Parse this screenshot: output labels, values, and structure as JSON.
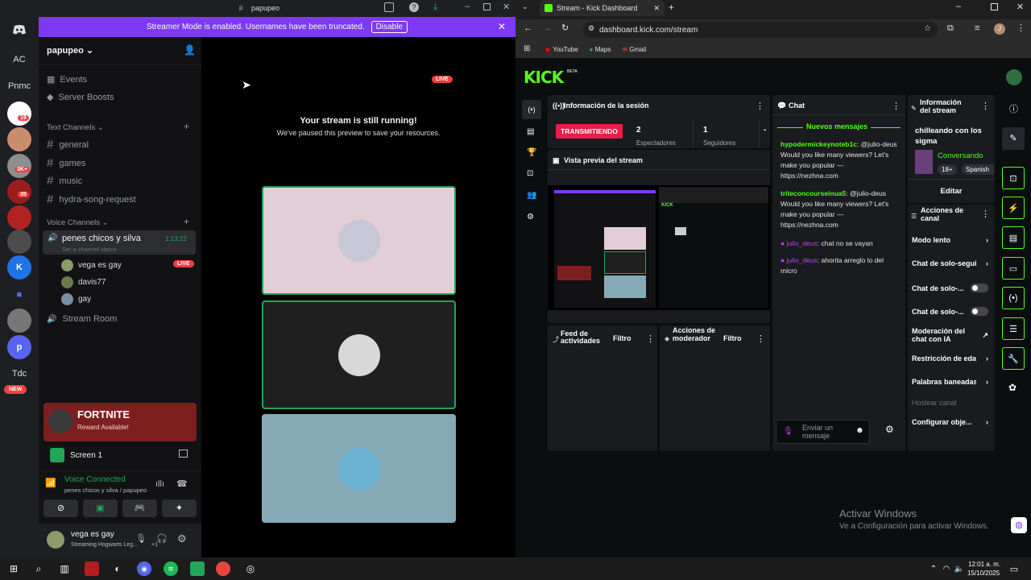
{
  "discord": {
    "window_title": "papupeo",
    "window_title_initial": "p",
    "banner": {
      "text": "Streamer Mode is enabled. Usernames have been truncated.",
      "button": "Disable"
    },
    "guilds": [
      {
        "label": "AC"
      },
      {
        "label": "Pnmc"
      },
      {
        "label": "Tdc"
      }
    ],
    "guild_badges": [
      "19",
      "3K+",
      "35"
    ],
    "new_badge": "NEW",
    "server_name": "papupeo",
    "menu": {
      "events": "Events",
      "boosts": "Server Boosts"
    },
    "text_channels_header": "Text Channels",
    "text_channels": [
      "general",
      "games",
      "music",
      "hydra-song-request"
    ],
    "voice_channels_header": "Voice Channels",
    "voice_channel": {
      "name": "penes chicos y silva",
      "timer": "1:13:22",
      "status": "Set a channel status"
    },
    "voice_users": [
      {
        "name": "vega es gay",
        "live": "LIVE"
      },
      {
        "name": "davis77"
      },
      {
        "name": "gay"
      }
    ],
    "stream_room": "Stream Room",
    "live_badge": "LIVE",
    "stream_paused": {
      "title": "Your stream is still running!",
      "subtitle": "We've paused this preview to save your resources."
    },
    "fortnite": {
      "title": "FORTNITE",
      "subtitle": "Reward Available!"
    },
    "screen_share": "Screen 1",
    "voice": {
      "status": "Voice Connected",
      "channel": "penes chicos y silva / papupeo"
    },
    "user": {
      "name": "vega es gay",
      "activity": "Streaming Hogwarts Leg...",
      "extra": "+1"
    }
  },
  "chrome": {
    "tab_title": "Stream - Kick Dashboard",
    "url": "dashboard.kick.com/stream",
    "bookmarks": [
      "YouTube",
      "Maps",
      "Gmail"
    ],
    "profile_initial": "J"
  },
  "kick": {
    "logo": "KICK",
    "logo_beta": "BETA",
    "session": {
      "title": "Información de la sesión",
      "status": "TRANSMITIENDO",
      "stats": [
        "2",
        "1",
        "-"
      ],
      "stat_labels": [
        "Espectadores",
        "Seguidores"
      ]
    },
    "preview_title": "Vista previa del stream",
    "activity_feed": {
      "title": "Feed de actividades",
      "filter": "Filtro"
    },
    "mod_actions": {
      "title": "Acciones de moderador",
      "filter": "Filtro"
    },
    "chat": {
      "title": "Chat",
      "new_messages": "Nuevos mensajes",
      "messages": [
        {
          "user": "hypodermickeynoteb1c",
          "text": ": @julio-deus Would you like many viewers? Let's make you popular — https://nezhna.com"
        },
        {
          "user": "triteconcourseinua5",
          "text": ": @julio-deus Would you like many viewers? Let's make you popular — https://nezhna.com"
        },
        {
          "user": "julio_deus",
          "text": ": chat no se vayan"
        },
        {
          "user": "julio_deus",
          "text": ": ahorita arreglo lo del micro"
        }
      ],
      "input_placeholder": "Enviar un mensaje"
    },
    "stream_info": {
      "title": "Información del stream",
      "stream_title": "chilleando con los sigma",
      "category": "Conversando",
      "tags": [
        "18+",
        "Spanish"
      ],
      "edit": "Editar"
    },
    "channel_actions": {
      "title": "Acciones de canal",
      "items": [
        "Modo lento",
        "Chat de solo-seguidores",
        "Chat de solo-...",
        "Chat de solo-...",
        "Moderación del chat con IA",
        "Restricción de edad",
        "Palabras baneadas",
        "Hostear canal",
        "Configurar obje..."
      ]
    }
  },
  "windows": {
    "activate_title": "Activar Windows",
    "activate_sub": "Ve a Configuración para activar Windows.",
    "time": "12:01 a. m.",
    "date": "15/10/2025"
  }
}
